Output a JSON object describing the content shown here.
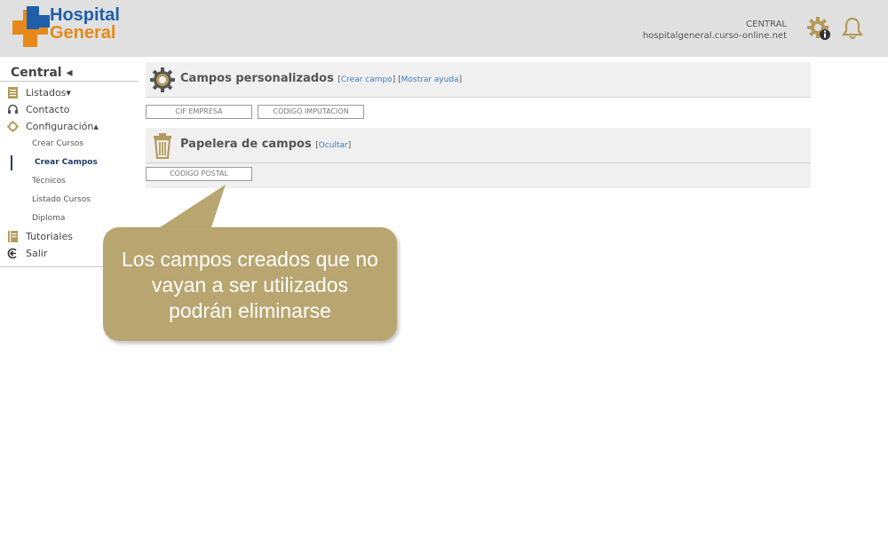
{
  "header": {
    "logo_line1": "Hospital",
    "logo_line2": "General",
    "account_name": "CENTRAL",
    "account_domain": "hospitalgeneral.curso-online.net",
    "icons": [
      "settings-info-icon",
      "bell-icon"
    ]
  },
  "sidebar": {
    "title": "Central ◂",
    "items": [
      {
        "label": "Listados▾",
        "icon": "list-icon"
      },
      {
        "label": "Contacto",
        "icon": "headset-icon"
      },
      {
        "label": "Configuración▴",
        "icon": "gear-icon"
      }
    ],
    "subitems": [
      {
        "label": "Crear Cursos"
      },
      {
        "label": "Crear Campos",
        "active": true
      },
      {
        "label": "Técnicos"
      },
      {
        "label": "Listado Cursos"
      },
      {
        "label": "Diploma"
      }
    ],
    "bottom_items": [
      {
        "label": "Tutoriales",
        "icon": "book-icon"
      },
      {
        "label": "Salir",
        "icon": "exit-icon"
      }
    ]
  },
  "main": {
    "custom_fields": {
      "title": "Campos personalizados",
      "create_link": "Crear campo",
      "help_link": "Mostrar ayuda",
      "fields": [
        "CIF EMPRESA",
        "CÓDIGO IMPUTACIÓN"
      ]
    },
    "trash": {
      "title": "Papelera de campos",
      "hide_link": "Ocultar",
      "fields": [
        "CÓDIGO POSTAL"
      ]
    }
  },
  "callout": {
    "line1": "Los campos creados que no",
    "line2": "vayan a ser utilizados",
    "line3": "podrán eliminarse"
  },
  "colors": {
    "header_bg": "#e0e0e0",
    "brand_blue": "#1f5fa8",
    "brand_orange": "#e58a1a",
    "link": "#3a7fc1",
    "callout_bg": "#b8a56f",
    "icon_gold": "#b39b5b"
  }
}
